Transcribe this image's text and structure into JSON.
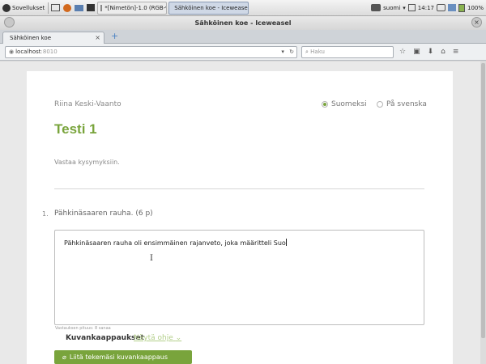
{
  "taskbar": {
    "apps_label": "Sovellukset",
    "tasks": [
      {
        "label": "*[Nimetön]-1.0 (RGB-väri, 1...",
        "active": false
      },
      {
        "label": "Sähköinen koe - Iceweasel",
        "active": true
      }
    ],
    "keyboard_layout": "suomi",
    "clock": "14:17",
    "battery": "100%"
  },
  "window": {
    "title": "Sähköinen koe - Iceweasel",
    "close_glyph": "×"
  },
  "browser": {
    "tab_label": "Sähköinen koe",
    "new_tab_glyph": "+",
    "url_host": "localhost",
    "url_port": ":8010",
    "search_placeholder": "Haku"
  },
  "exam": {
    "student_name": "Riina Keski-Vaanto",
    "lang_finnish": "Suomeksi",
    "lang_swedish": "På svenska",
    "title": "Testi 1",
    "instructions": "Vastaa kysymyksiin.",
    "question_number": "1.",
    "question_text": "Pähkinäsaaren rauha. (6 p)",
    "answer_text": "Pähkinäsaaren rauha oli ensimmäinen rajanveto, joka määritteli Suo",
    "char_count": "Vastauksen pituus: 8 sanaa",
    "images_heading": "Kuvankaappaukset",
    "help_link": "Näytä ohje",
    "attach_button": "Liitä tekemäsi kuvankaappaus"
  },
  "colors": {
    "accent_green": "#79a43c"
  }
}
